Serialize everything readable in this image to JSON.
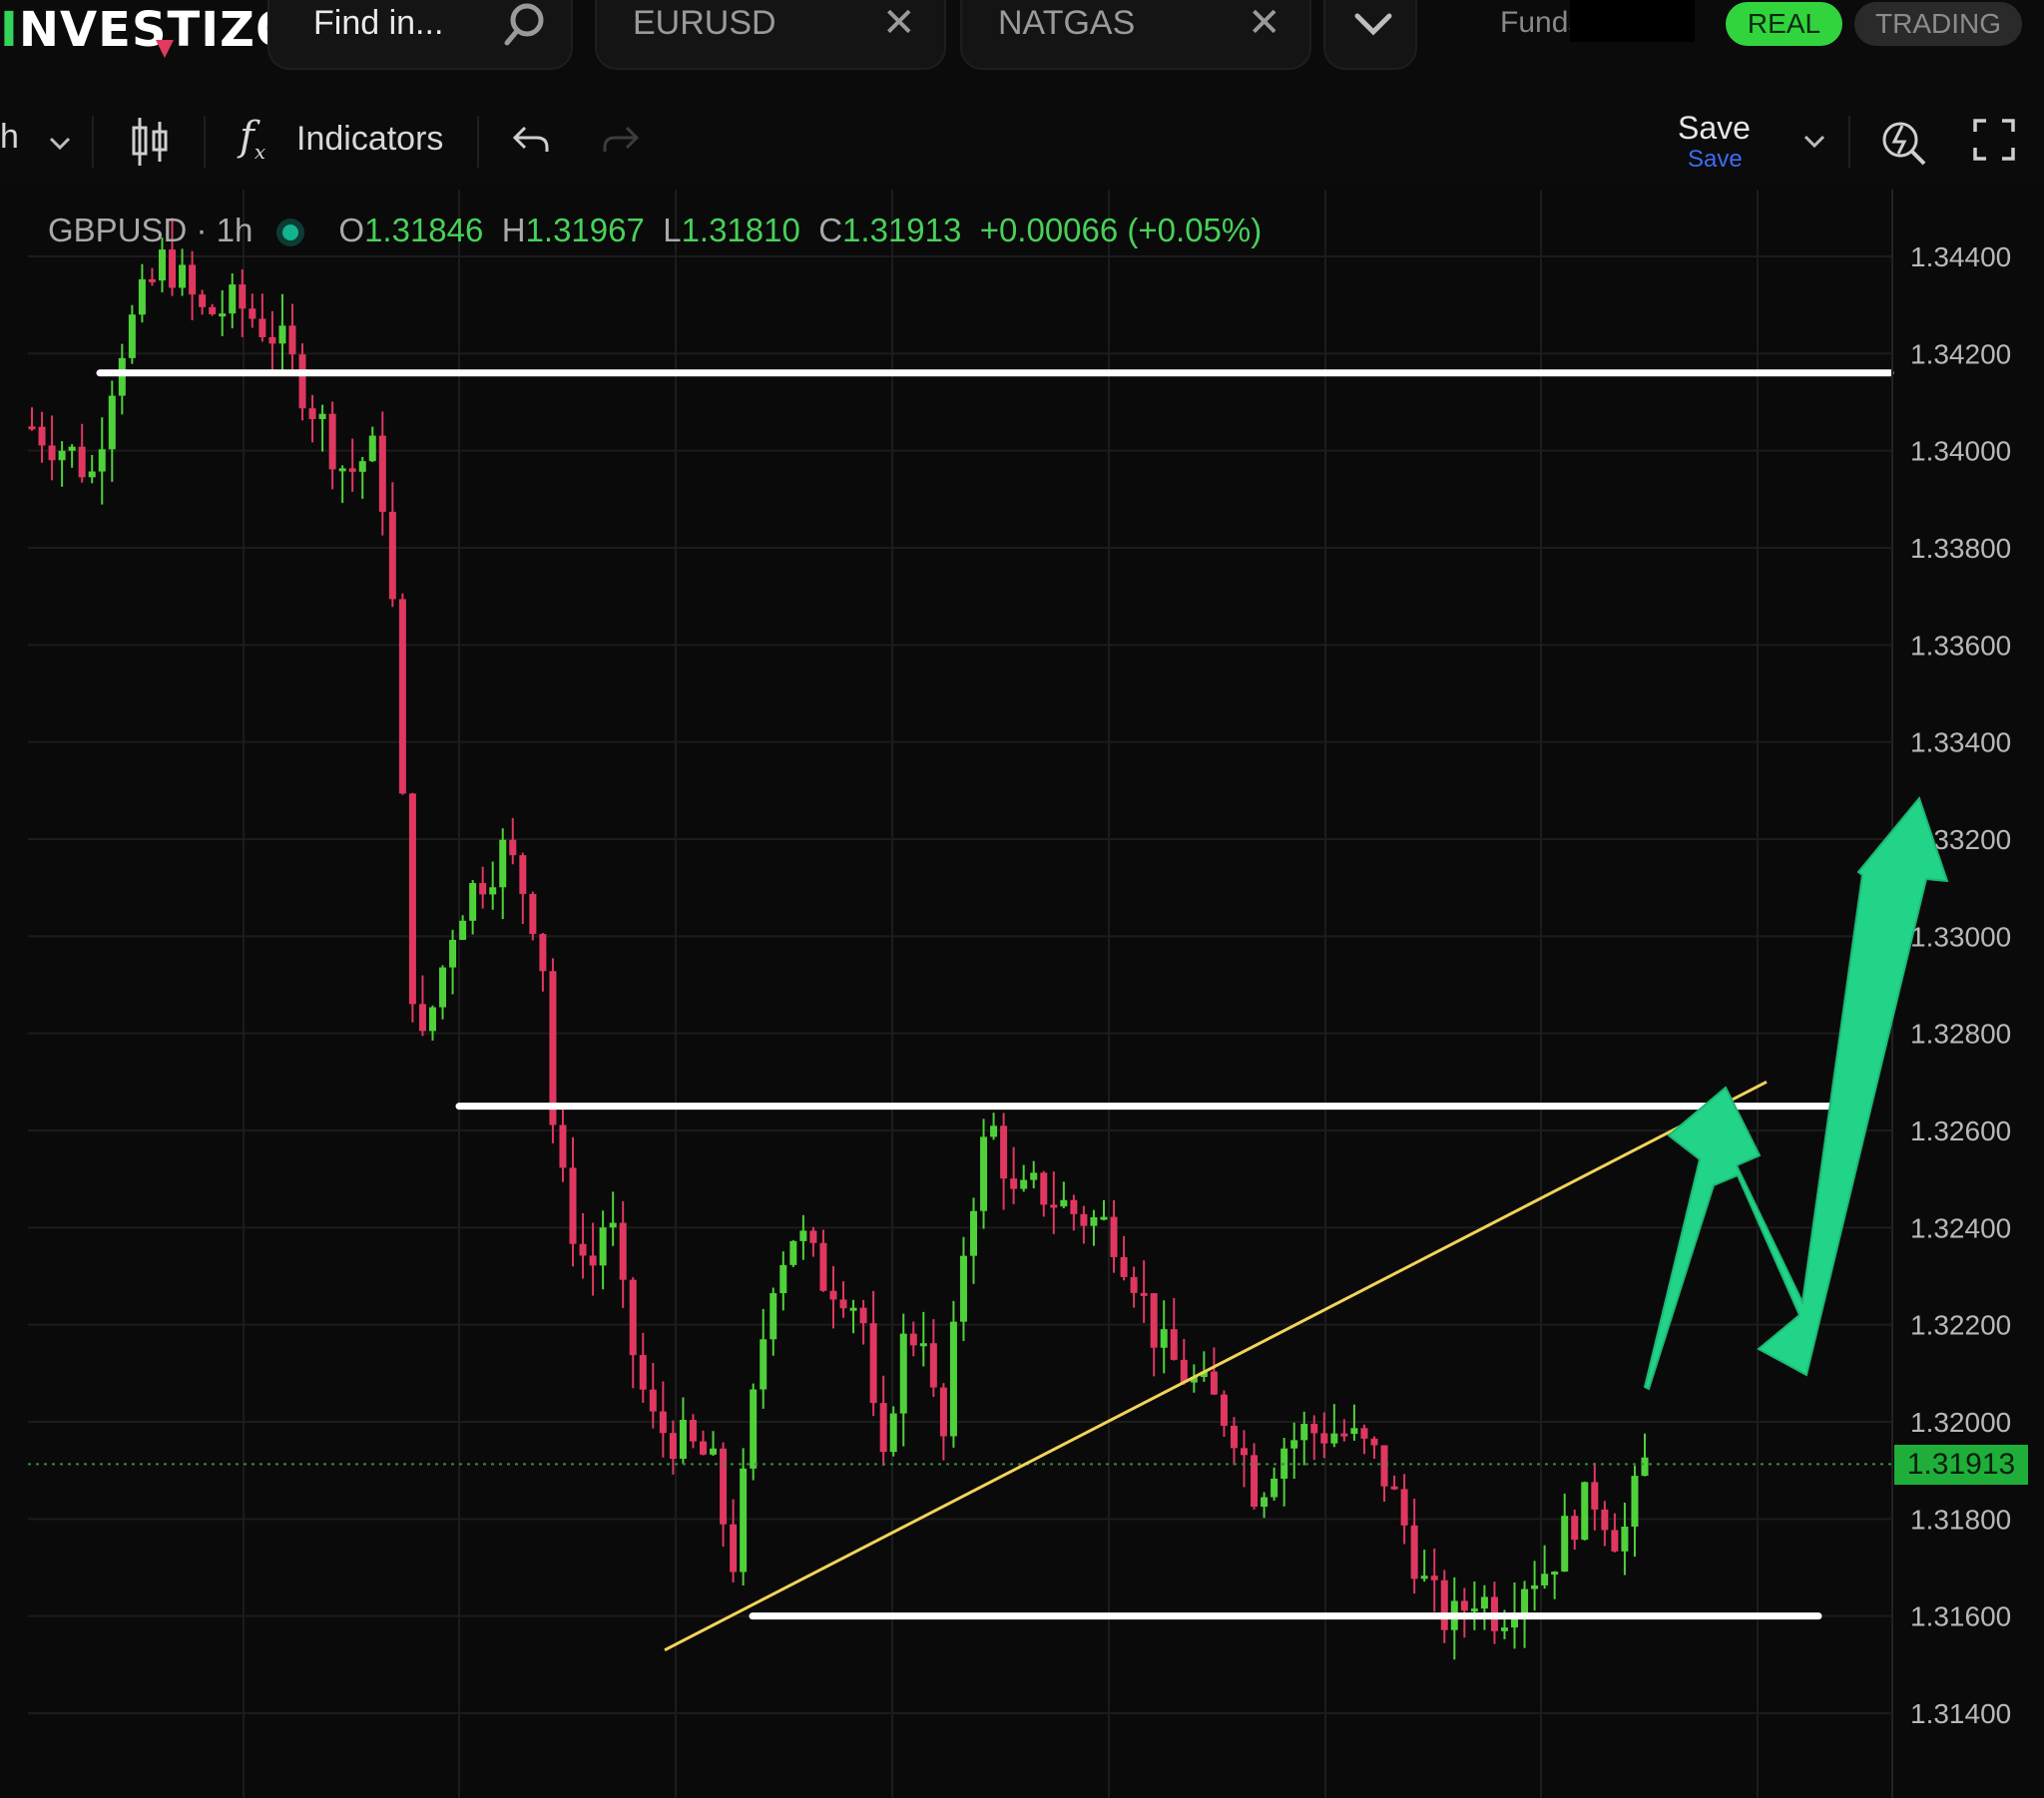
{
  "brand": {
    "name": "INVESTIZO"
  },
  "search": {
    "placeholder": "Find in..."
  },
  "tabs": [
    {
      "label": "EURUSD"
    },
    {
      "label": "NATGAS"
    }
  ],
  "account": {
    "funds_label": "Funds",
    "mode_real": "REAL",
    "mode_trading": "TRADING"
  },
  "toolbar": {
    "interval": "h",
    "indicators_label": "Indicators",
    "save_label": "Save",
    "save_sub": "Save"
  },
  "legend": {
    "symbol_interval": "GBPUSD · 1h",
    "o_label": "O",
    "o": "1.31846",
    "h_label": "H",
    "h": "1.31967",
    "l_label": "L",
    "l": "1.31810",
    "c_label": "C",
    "c": "1.31913",
    "change": "+0.00066 (+0.05%)"
  },
  "colors": {
    "up": "#4fd13a",
    "down": "#e03760",
    "accent": "#22d487",
    "trendline": "#f2d35a",
    "level": "#ffffff",
    "background": "#0a0a0a"
  },
  "chart_data": {
    "type": "candlestick",
    "symbol": "GBPUSD",
    "interval": "1h",
    "y_axis_ticks": [
      "1.34400",
      "1.34200",
      "1.34000",
      "1.33800",
      "1.33600",
      "1.33400",
      "1.33200",
      "1.33000",
      "1.32800",
      "1.32600",
      "1.32400",
      "1.32200",
      "1.32000",
      "1.31800",
      "1.31600",
      "1.31400"
    ],
    "ylim": [
      1.312,
      1.3455
    ],
    "grid": true,
    "last_price": "1.31913",
    "candle_count": 162,
    "price_path": [
      [
        0,
        1.3405
      ],
      [
        6,
        1.34
      ],
      [
        10,
        1.3395
      ],
      [
        14,
        1.342
      ],
      [
        18,
        1.343
      ],
      [
        22,
        1.344
      ],
      [
        28,
        1.3428
      ],
      [
        34,
        1.343
      ],
      [
        40,
        1.3424
      ],
      [
        44,
        1.3415
      ],
      [
        48,
        1.3405
      ],
      [
        52,
        1.3395
      ],
      [
        56,
        1.34
      ],
      [
        58,
        1.339
      ],
      [
        60,
        1.336
      ],
      [
        62,
        1.33
      ],
      [
        64,
        1.3275
      ],
      [
        66,
        1.3285
      ],
      [
        70,
        1.3305
      ],
      [
        74,
        1.3312
      ],
      [
        78,
        1.3318
      ],
      [
        81,
        1.331
      ],
      [
        84,
        1.33
      ],
      [
        86,
        1.326
      ],
      [
        88,
        1.3245
      ],
      [
        92,
        1.323
      ],
      [
        95,
        1.3245
      ],
      [
        98,
        1.322
      ],
      [
        102,
        1.32
      ],
      [
        108,
        1.3195
      ],
      [
        112,
        1.3192
      ],
      [
        114,
        1.318
      ],
      [
        116,
        1.317
      ],
      [
        118,
        1.3195
      ],
      [
        122,
        1.323
      ],
      [
        126,
        1.324
      ],
      [
        130,
        1.323
      ],
      [
        134,
        1.3228
      ],
      [
        137,
        1.3222
      ],
      [
        140,
        1.3185
      ],
      [
        143,
        1.3215
      ],
      [
        147,
        1.322
      ],
      [
        150,
        1.3192
      ],
      [
        154,
        1.324
      ],
      [
        158,
        1.3262
      ],
      [
        160,
        1.3255
      ],
      [
        162,
        1.3245
      ],
      [
        166,
        1.3248
      ],
      [
        172,
        1.3243
      ],
      [
        178,
        1.324
      ],
      [
        182,
        1.323
      ],
      [
        186,
        1.3215
      ],
      [
        190,
        1.321
      ],
      [
        194,
        1.3205
      ],
      [
        198,
        1.32
      ],
      [
        202,
        1.3185
      ],
      [
        206,
        1.3195
      ],
      [
        210,
        1.3198
      ],
      [
        216,
        1.3198
      ],
      [
        222,
        1.3192
      ],
      [
        226,
        1.318
      ],
      [
        230,
        1.3165
      ],
      [
        234,
        1.3158
      ],
      [
        238,
        1.3165
      ],
      [
        242,
        1.316
      ],
      [
        246,
        1.3168
      ],
      [
        250,
        1.317
      ],
      [
        254,
        1.318
      ],
      [
        258,
        1.3185
      ],
      [
        262,
        1.3175
      ],
      [
        266,
        1.3191
      ]
    ],
    "drawings": {
      "horizontal_levels": [
        1.3416,
        1.3265,
        1.316
      ],
      "trendline": {
        "from": [
          1.3153
        ],
        "to": [
          1.327
        ]
      },
      "projection_arrow": "zigzag up: rise to 1.3265, dip to 1.3210, then up toward 1.3330"
    }
  }
}
